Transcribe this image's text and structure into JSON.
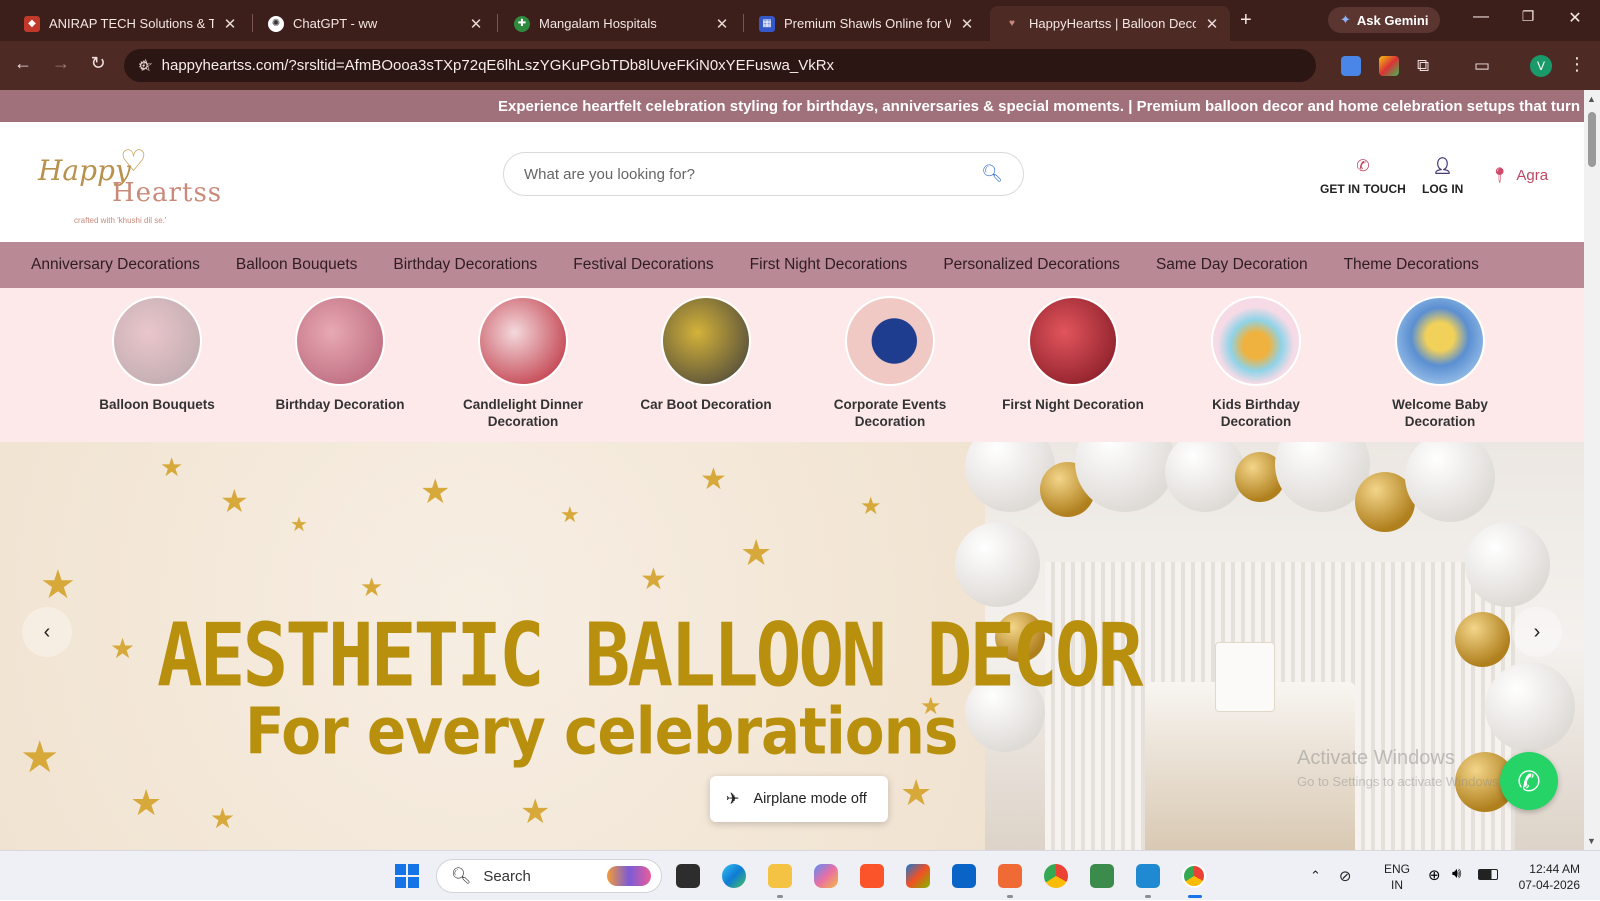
{
  "browser": {
    "tabs": [
      {
        "title": "ANIRAP TECH Solutions & Tech",
        "favicon_color": "#c0392b"
      },
      {
        "title": "ChatGPT - ww",
        "favicon_color": "#ffffff"
      },
      {
        "title": "Mangalam Hospitals",
        "favicon_color": "#2e8b3e"
      },
      {
        "title": "Premium Shawls Online for Wo",
        "favicon_color": "#3558c9"
      },
      {
        "title": "HappyHeartss | Balloon Decora",
        "favicon_color": "#c98a7a"
      }
    ],
    "ask_gemini": "Ask Gemini",
    "url": "happyheartss.com/?srsltid=AfmBOooa3sTXp72qE6lhLszYGKuPGbTDb8lUveFKiN0xYEFuswa_VkRx",
    "profile_initial": "V"
  },
  "site": {
    "announcement": "Experience heartfelt celebration styling for birthdays, anniversaries & special moments.   |   Premium balloon decor and home celebration setups that turn moments into",
    "logo": {
      "line1": "Happy",
      "line2": "Heartss",
      "tagline": "crafted with 'khushi dil se.'"
    },
    "search_placeholder": "What are you looking for?",
    "get_in_touch": "GET IN TOUCH",
    "login": "LOG IN",
    "location": "Agra",
    "nav": [
      "Anniversary Decorations",
      "Balloon Bouquets",
      "Birthday Decorations",
      "Festival Decorations",
      "First Night Decorations",
      "Personalized Decorations",
      "Same Day Decoration",
      "Theme Decorations"
    ],
    "categories": [
      {
        "label": "Balloon Bouquets",
        "c1": "#e9c6cc",
        "c2": "#b8a7a9"
      },
      {
        "label": "Birthday Decoration",
        "c1": "#e8a9b3",
        "c2": "#b45f74"
      },
      {
        "label": "Candlelight Dinner Decoration",
        "c1": "#f3d9dc",
        "c2": "#b81f2e"
      },
      {
        "label": "Car Boot Decoration",
        "c1": "#3b3b3b",
        "c2": "#d4b23a"
      },
      {
        "label": "Corporate Events Decoration",
        "c1": "#f0c9c4",
        "c2": "#1e3d8f"
      },
      {
        "label": "First Night Decoration",
        "c1": "#7a1420",
        "c2": "#e2555c"
      },
      {
        "label": "Kids Birthday Decoration",
        "c1": "#f6dbe6",
        "c2": "#f0b23e"
      },
      {
        "label": "Welcome Baby Decoration",
        "c1": "#5b8fd1",
        "c2": "#f2d15a"
      }
    ],
    "hero": {
      "title": "AESTHETIC BALLOON DECOR",
      "subtitle": "For every celebrations"
    },
    "toast": "Airplane mode off",
    "watermark_title": "Activate Windows",
    "watermark_sub": "Go to Settings to activate Windows."
  },
  "taskbar": {
    "search_label": "Search",
    "lang_line1": "ENG",
    "lang_line2": "IN",
    "time": "12:44 AM",
    "date": "07-04-2026"
  }
}
